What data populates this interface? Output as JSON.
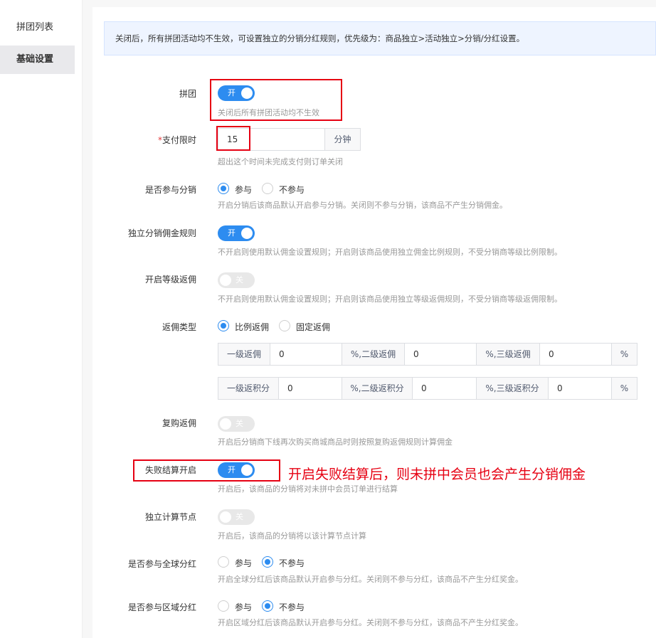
{
  "sidebar": {
    "items": [
      {
        "label": "拼团列表",
        "active": false
      },
      {
        "label": "基础设置",
        "active": true
      }
    ]
  },
  "notice": "关闭后，所有拼团活动均不生效，可设置独立的分销分红规则，优先级为：商品独立>活动独立>分销/分红设置。",
  "form": {
    "pintuan": {
      "label": "拼团",
      "toggle": "开",
      "state": "on",
      "hint": "关闭后所有拼团活动均不生效"
    },
    "pay_limit": {
      "required_mark": "*",
      "label": "支付限时",
      "value": "15",
      "unit": "分钟",
      "hint": "超出这个时间未完成支付则订单关闭"
    },
    "join_distribution": {
      "label": "是否参与分销",
      "options": [
        "参与",
        "不参与"
      ],
      "selected": "参与",
      "hint": "开启分销后该商品默认开启参与分销。关闭则不参与分销，该商品不产生分销佣金。"
    },
    "independent_commission": {
      "label": "独立分销佣金规则",
      "toggle": "开",
      "state": "on",
      "hint": "不开启则使用默认佣金设置规则；开启则该商品使用独立佣金比例规则，不受分销商等级比例限制。"
    },
    "level_rebate": {
      "label": "开启等级返佣",
      "toggle": "关",
      "state": "off",
      "hint": "不开启则使用默认佣金设置规则；开启则该商品使用独立等级返佣规则，不受分销商等级返佣限制。"
    },
    "rebate_type": {
      "label": "返佣类型",
      "options": [
        "比例返佣",
        "固定返佣"
      ],
      "selected": "比例返佣",
      "row1": {
        "addon1": "一级返佣",
        "value1": "0",
        "addon2": "%,二级返佣",
        "value2": "0",
        "addon3": "%,三级返佣",
        "value3": "0",
        "suffix": "%"
      },
      "row2": {
        "addon1": "一级返积分",
        "value1": "0",
        "addon2": "%,二级返积分",
        "value2": "0",
        "addon3": "%,三级返积分",
        "value3": "0",
        "suffix": "%"
      }
    },
    "repurchase": {
      "label": "复购返佣",
      "toggle": "关",
      "state": "off",
      "hint": "开启后分销商下线再次购买商城商品时则按照复购返佣规则计算佣金"
    },
    "fail_settle": {
      "label": "失败结算开启",
      "toggle": "开",
      "state": "on",
      "hint": "开启后，该商品的分销将对未拼中会员订单进行结算"
    },
    "independent_node": {
      "label": "独立计算节点",
      "toggle": "关",
      "state": "off",
      "hint": "开启后，该商品的分销将以该计算节点计算"
    },
    "global_dividend": {
      "label": "是否参与全球分红",
      "options": [
        "参与",
        "不参与"
      ],
      "selected": "不参与",
      "hint": "开启全球分红后该商品默认开启参与分红。关闭则不参与分红，该商品不产生分红奖金。"
    },
    "regional_dividend": {
      "label": "是否参与区域分红",
      "options": [
        "参与",
        "不参与"
      ],
      "selected": "不参与",
      "hint": "开启区域分红后该商品默认开启参与分红。关闭则不参与分红，该商品不产生分红奖金。"
    }
  },
  "annotation": "开启失败结算后，则未拼中会员也会产生分销佣金",
  "colors": {
    "primary": "#2d8cf0",
    "highlight_red": "#e60012",
    "notice_bg": "#eef4ff"
  }
}
